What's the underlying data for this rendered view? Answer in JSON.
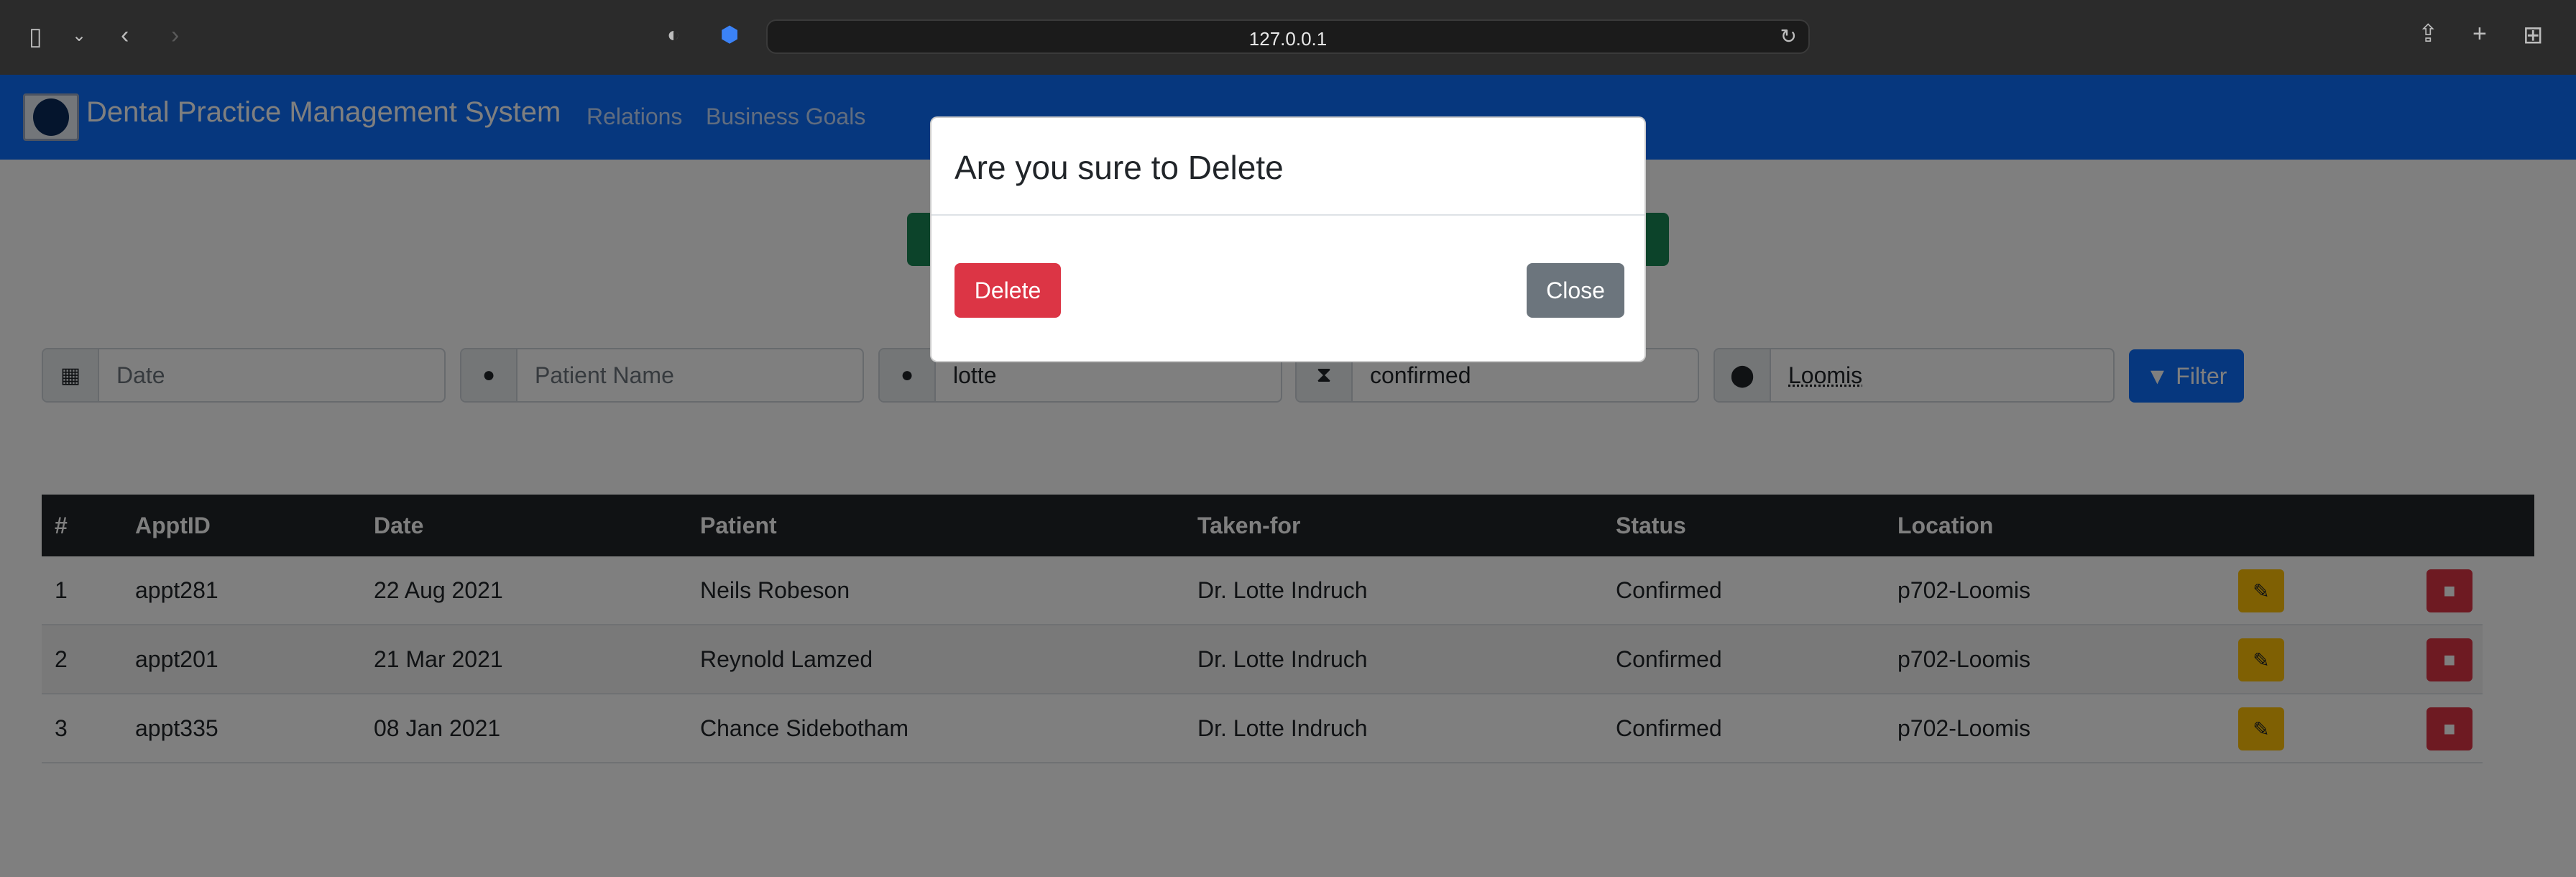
{
  "browser": {
    "url": "127.0.0.1",
    "icons": [
      "sidebar-icon",
      "chevron-down-icon",
      "back-icon",
      "forward-icon",
      "shield-icon",
      "extension-icon",
      "reload-icon",
      "share-icon",
      "new-tab-icon",
      "tab-overview-icon"
    ]
  },
  "navbar": {
    "brand": "Dental Practice Management System",
    "links": [
      "Relations",
      "Business Goals"
    ]
  },
  "filters": {
    "date_placeholder": "Date",
    "patient_placeholder": "Patient Name",
    "doctor_value": "lotte",
    "status_value": "confirmed",
    "location_value": "Loomis",
    "filter_label": "Filter"
  },
  "table": {
    "headers": [
      "#",
      "ApptID",
      "Date",
      "Patient",
      "Taken-for",
      "Status",
      "Location"
    ],
    "rows": [
      [
        "1",
        "appt281",
        "22 Aug 2021",
        "Neils Robeson",
        "Dr. Lotte Indruch",
        "Confirmed",
        "p702-Loomis"
      ],
      [
        "2",
        "appt201",
        "21 Mar 2021",
        "Reynold Lamzed",
        "Dr. Lotte Indruch",
        "Confirmed",
        "p702-Loomis"
      ],
      [
        "3",
        "appt335",
        "08 Jan 2021",
        "Chance Sidebotham",
        "Dr. Lotte Indruch",
        "Confirmed",
        "p702-Loomis"
      ]
    ]
  },
  "modal": {
    "title": "Are you sure to Delete",
    "delete_label": "Delete",
    "close_label": "Close"
  },
  "colors": {
    "primary": "#0d6efd",
    "danger": "#dc3545",
    "warning": "#ffc107",
    "secondary": "#6c757d",
    "success": "#198754",
    "table_header": "#212529"
  }
}
